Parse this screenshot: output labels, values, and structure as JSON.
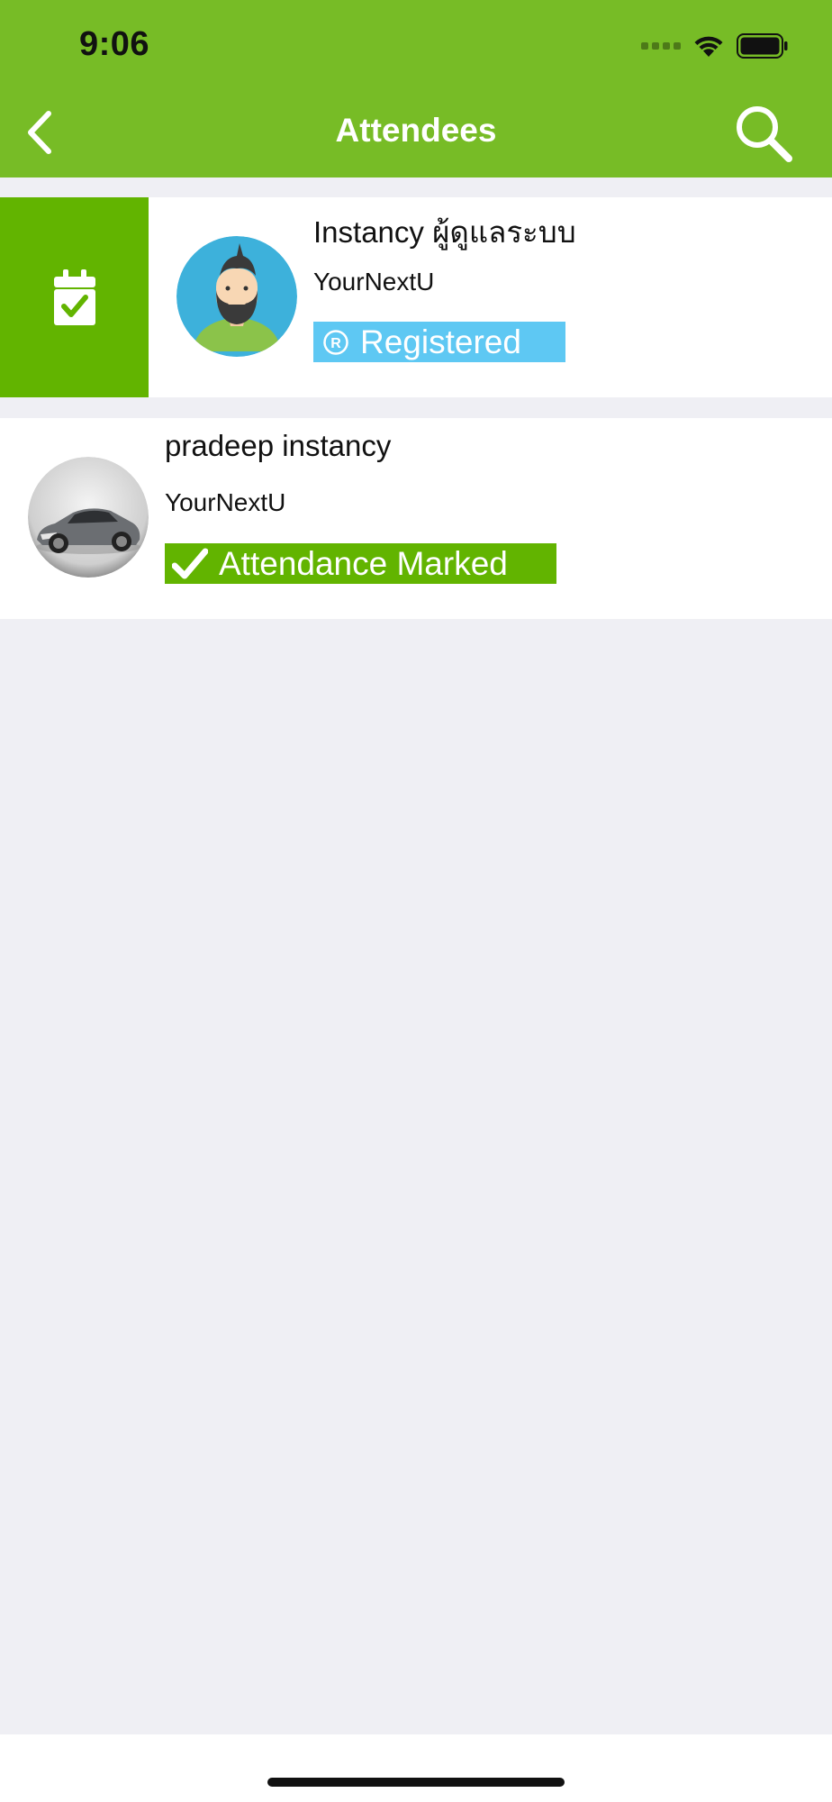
{
  "status_bar": {
    "time": "9:06"
  },
  "nav": {
    "title": "Attendees",
    "back_icon": "chevron-left-icon",
    "search_icon": "search-icon"
  },
  "attendees": [
    {
      "name": "Instancy ผู้ดูแลระบบ",
      "organization": "YourNextU",
      "status": "Registered",
      "status_icon": "registered-icon",
      "status_color": "#5ec8f3",
      "avatar": "bearded-man-avatar",
      "swipe_action_icon": "calendar-check-icon",
      "swipe_action_color": "#62b400"
    },
    {
      "name": "pradeep instancy",
      "organization": "YourNextU",
      "status": "Attendance Marked",
      "status_icon": "checkmark-icon",
      "status_color": "#62b400",
      "avatar": "car-photo-avatar"
    }
  ],
  "colors": {
    "header": "#77bc26",
    "background": "#efeff4"
  }
}
